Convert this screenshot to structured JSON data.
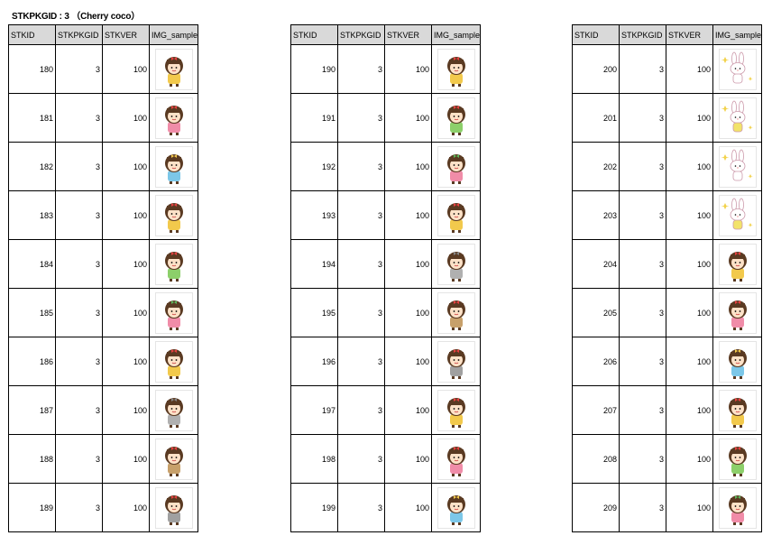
{
  "header": {
    "title": "STKPKGID : 3 （Cherry coco）"
  },
  "columns": [
    "STKID",
    "STKPKGID",
    "STKVER",
    "IMG_sample"
  ],
  "tables": [
    {
      "rows": [
        {
          "stkid": "180",
          "pkg": "3",
          "ver": "100",
          "icon": "girl-hearts-icon"
        },
        {
          "stkid": "181",
          "pkg": "3",
          "ver": "100",
          "icon": "girl-peeking-icon"
        },
        {
          "stkid": "182",
          "pkg": "3",
          "ver": "100",
          "icon": "girl-flower-crown-icon"
        },
        {
          "stkid": "183",
          "pkg": "3",
          "ver": "100",
          "icon": "girl-red-bow-icon"
        },
        {
          "stkid": "184",
          "pkg": "3",
          "ver": "100",
          "icon": "girl-waving-icon"
        },
        {
          "stkid": "185",
          "pkg": "3",
          "ver": "100",
          "icon": "girl-worried-icon"
        },
        {
          "stkid": "186",
          "pkg": "3",
          "ver": "100",
          "icon": "girl-sleepy-icon"
        },
        {
          "stkid": "187",
          "pkg": "3",
          "ver": "100",
          "icon": "girl-gloomy-icon"
        },
        {
          "stkid": "188",
          "pkg": "3",
          "ver": "100",
          "icon": "girl-crying-icon"
        },
        {
          "stkid": "189",
          "pkg": "3",
          "ver": "100",
          "icon": "girl-standing-icon"
        }
      ]
    },
    {
      "rows": [
        {
          "stkid": "190",
          "pkg": "3",
          "ver": "100",
          "icon": "girl-yellow-dress-icon"
        },
        {
          "stkid": "191",
          "pkg": "3",
          "ver": "100",
          "icon": "girl-pink-dress-icon"
        },
        {
          "stkid": "192",
          "pkg": "3",
          "ver": "100",
          "icon": "girl-hat-icon"
        },
        {
          "stkid": "193",
          "pkg": "3",
          "ver": "100",
          "icon": "girl-blanket-icon"
        },
        {
          "stkid": "194",
          "pkg": "3",
          "ver": "100",
          "icon": "two-girls-icon"
        },
        {
          "stkid": "195",
          "pkg": "3",
          "ver": "100",
          "icon": "girl-green-bow-icon"
        },
        {
          "stkid": "196",
          "pkg": "3",
          "ver": "100",
          "icon": "girls-slide-icon"
        },
        {
          "stkid": "197",
          "pkg": "3",
          "ver": "100",
          "icon": "girls-hug-icon"
        },
        {
          "stkid": "198",
          "pkg": "3",
          "ver": "100",
          "icon": "girl-bunny-hood-icon"
        },
        {
          "stkid": "199",
          "pkg": "3",
          "ver": "100",
          "icon": "girl-bunny-ears-icon"
        }
      ]
    },
    {
      "rows": [
        {
          "stkid": "200",
          "pkg": "3",
          "ver": "100",
          "icon": "bunny-sparkle-icon"
        },
        {
          "stkid": "201",
          "pkg": "3",
          "ver": "100",
          "icon": "bunny-standing-icon"
        },
        {
          "stkid": "202",
          "pkg": "3",
          "ver": "100",
          "icon": "bunny-snail-icon"
        },
        {
          "stkid": "203",
          "pkg": "3",
          "ver": "100",
          "icon": "bunny-lying-icon"
        },
        {
          "stkid": "204",
          "pkg": "3",
          "ver": "100",
          "icon": "girl-painting-icon"
        },
        {
          "stkid": "205",
          "pkg": "3",
          "ver": "100",
          "icon": "girl-party-hat-icon"
        },
        {
          "stkid": "206",
          "pkg": "3",
          "ver": "100",
          "icon": "girl-alarm-clock-icon"
        },
        {
          "stkid": "207",
          "pkg": "3",
          "ver": "100",
          "icon": "girl-lamp-sleeping-icon"
        },
        {
          "stkid": "208",
          "pkg": "3",
          "ver": "100",
          "icon": "girl-rocking-horse-icon"
        },
        {
          "stkid": "209",
          "pkg": "3",
          "ver": "100",
          "icon": "girl-drawing-icon"
        }
      ]
    }
  ]
}
